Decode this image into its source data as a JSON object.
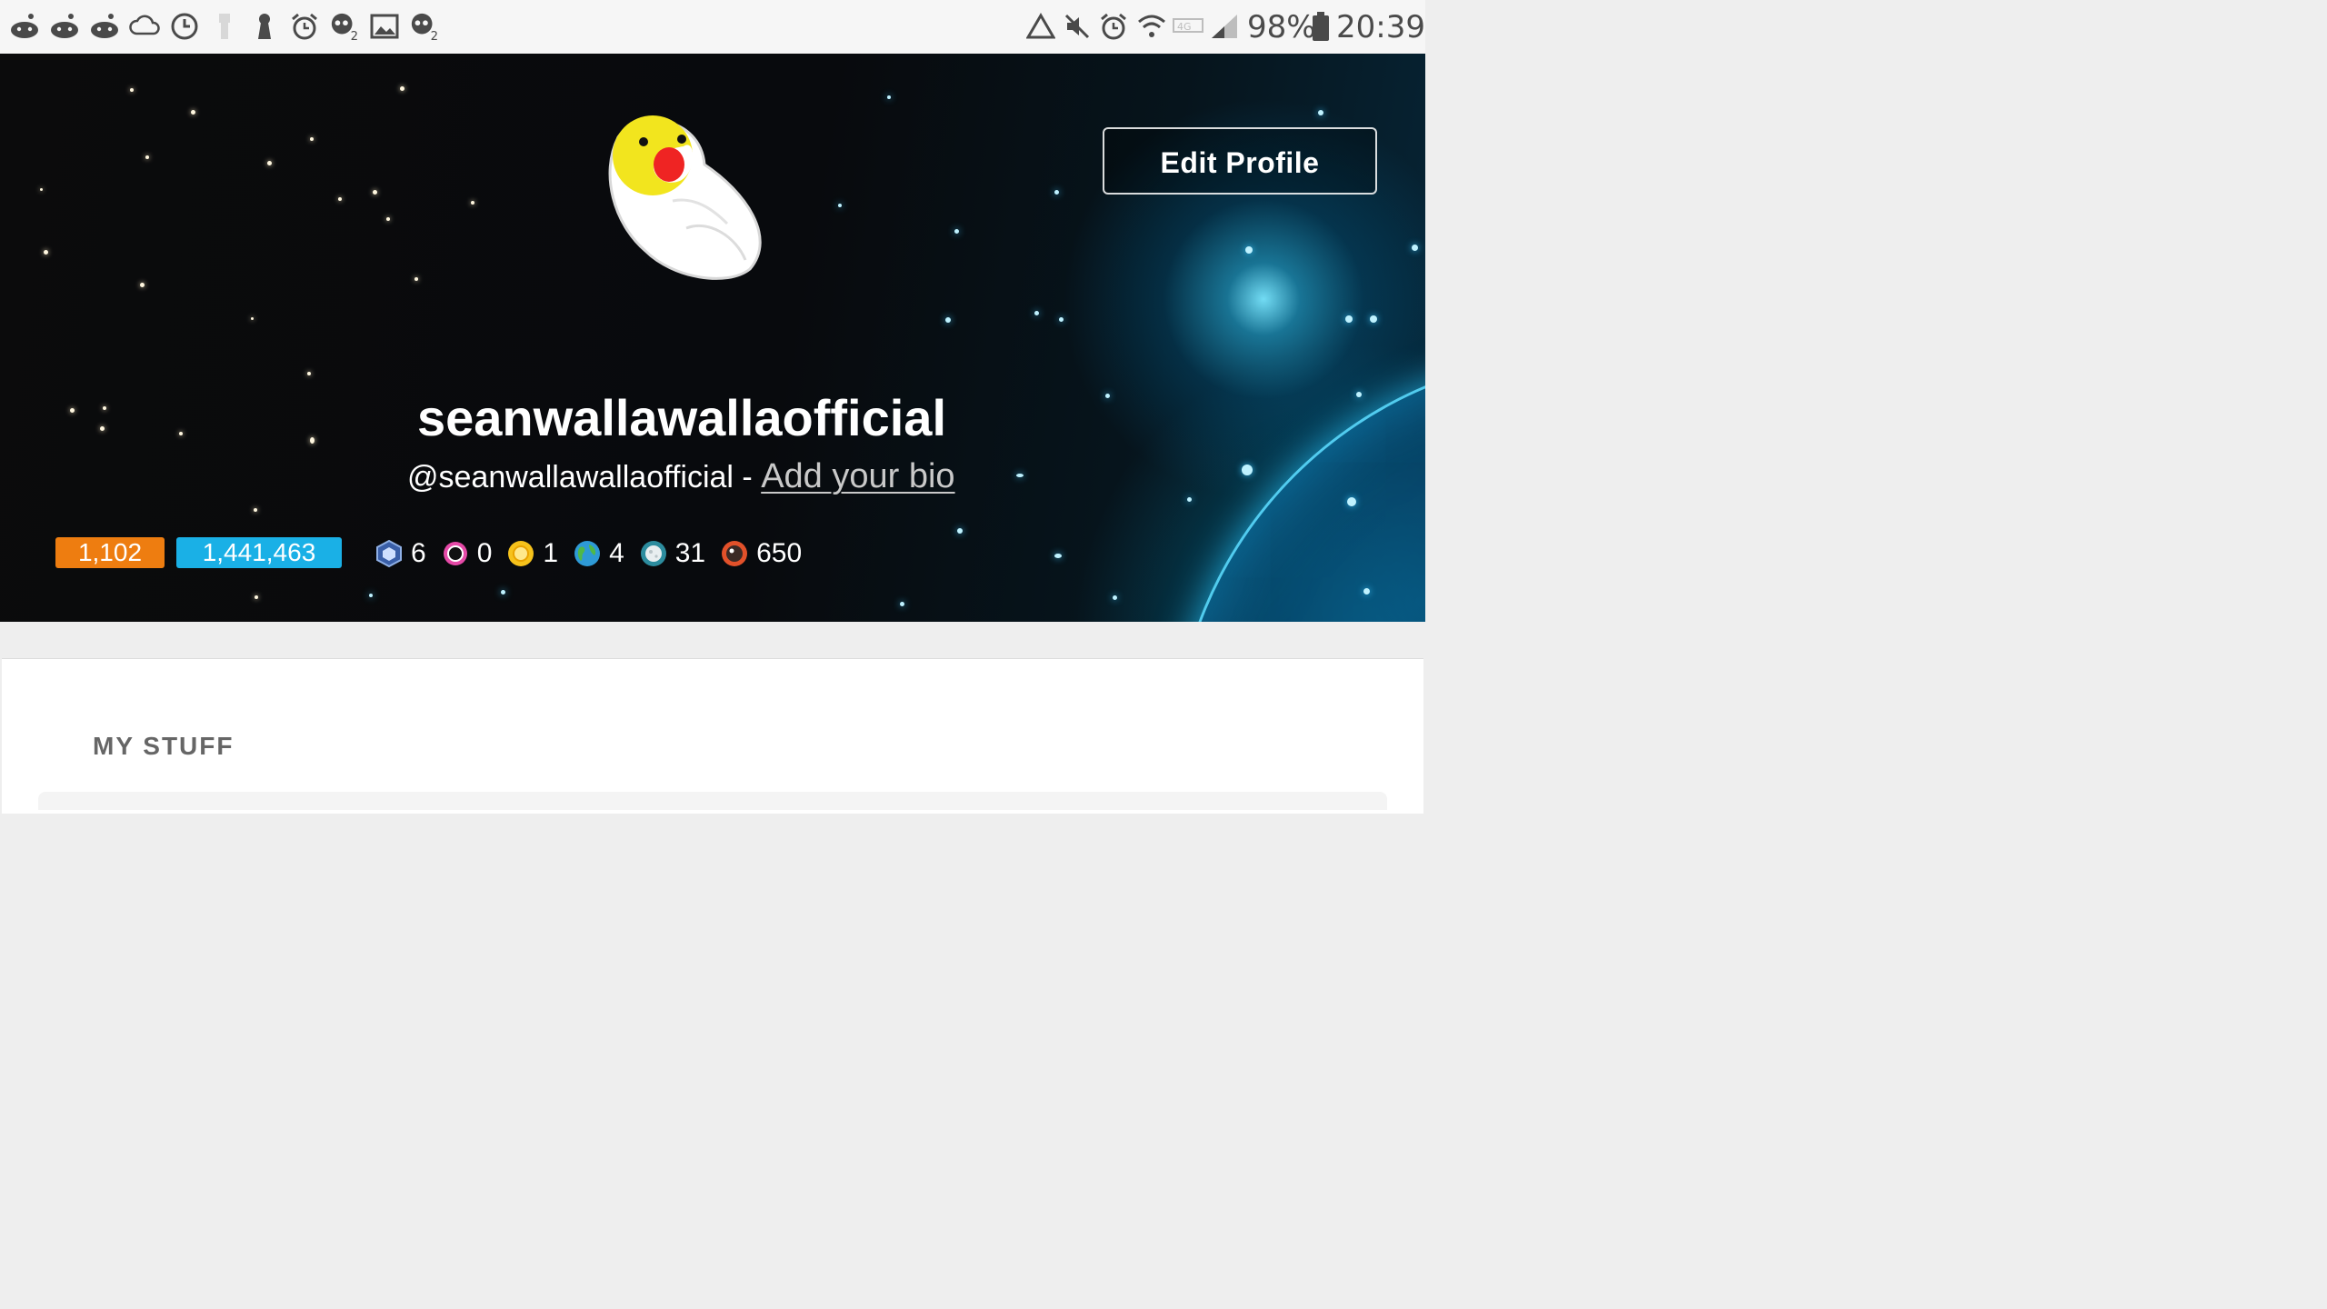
{
  "status_bar": {
    "left_icons": [
      "reddit-icon",
      "reddit-icon",
      "reddit-icon",
      "cloud-sync-icon",
      "clock-icon",
      "flashlight-icon",
      "keyhole-icon",
      "alarm-icon",
      "game-notification-icon",
      "image-icon",
      "game-notification-icon"
    ],
    "right_icons": [
      "recycle-icon",
      "mute-icon",
      "alarm-icon",
      "wifi-icon",
      "lte-icon",
      "signal-icon"
    ],
    "battery": "98%",
    "time": "20:39"
  },
  "profile": {
    "display_name": "seanwallawallaofficial",
    "handle": "@seanwallawallaofficial",
    "separator": " - ",
    "bio_link": "Add your bio",
    "edit_button": "Edit Profile",
    "karma_post": "1,102",
    "karma_comment": "1,441,463",
    "trophies": [
      {
        "icon": "hexagon-badge-icon",
        "count": "6"
      },
      {
        "icon": "ring-badge-icon",
        "count": "0"
      },
      {
        "icon": "sun-badge-icon",
        "count": "1"
      },
      {
        "icon": "earth-badge-icon",
        "count": "4"
      },
      {
        "icon": "moon-badge-icon",
        "count": "31"
      },
      {
        "icon": "asteroid-badge-icon",
        "count": "650"
      }
    ]
  },
  "content": {
    "section_title": "MY STUFF"
  },
  "colors": {
    "karma_post": "#ee7d10",
    "karma_comment": "#1ab0e6",
    "banner_glow": "#28c8f0"
  }
}
